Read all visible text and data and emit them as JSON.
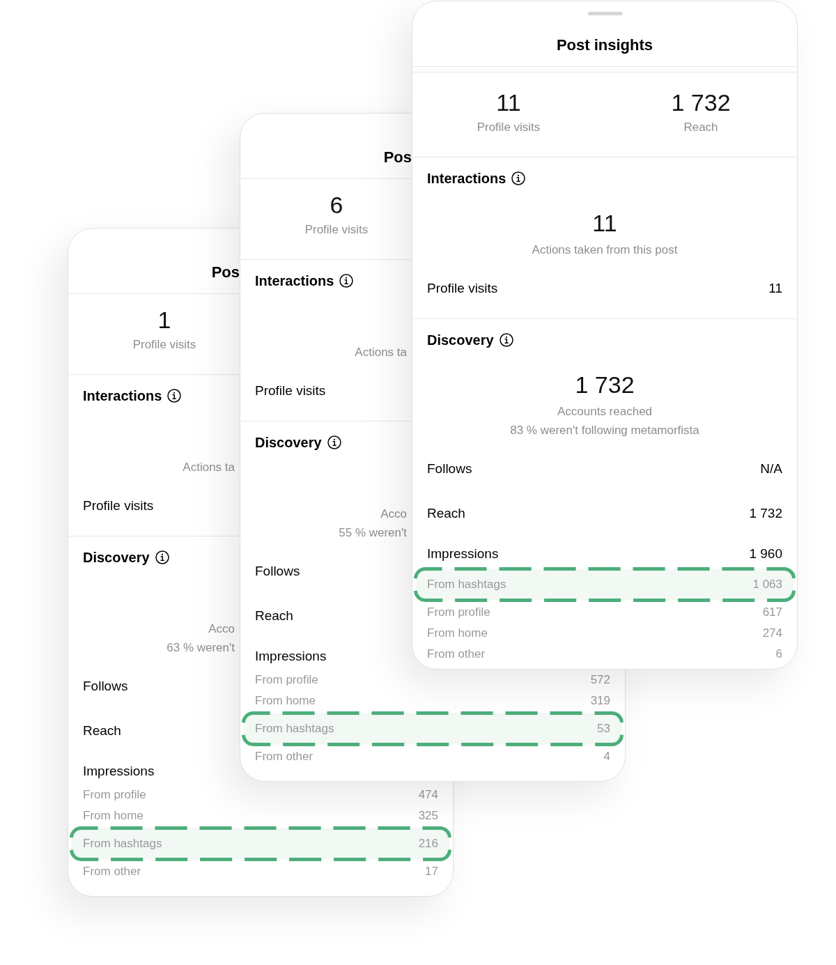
{
  "cards": [
    {
      "handle": false,
      "title": "Pos",
      "stats": [
        {
          "value": "1",
          "label": "Profile visits"
        }
      ],
      "sections": [
        {
          "heading": "Interactions",
          "caption": "Actions ta",
          "rows": [
            {
              "label": "Profile visits"
            }
          ]
        },
        {
          "heading": "Discovery",
          "caption": "Acco",
          "subcaption": "63 % weren't",
          "rows": [
            {
              "label": "Follows"
            },
            {
              "label": "Reach"
            },
            {
              "label": "Impressions",
              "breakdown": [
                {
                  "label": "From profile",
                  "value": "474",
                  "highlighted": false
                },
                {
                  "label": "From home",
                  "value": "325",
                  "highlighted": false
                },
                {
                  "label": "From hashtags",
                  "value": "216",
                  "highlighted": true
                },
                {
                  "label": "From other",
                  "value": "17",
                  "highlighted": false
                }
              ]
            }
          ]
        }
      ]
    },
    {
      "handle": false,
      "title": "Pos",
      "stats": [
        {
          "value": "6",
          "label": "Profile visits"
        }
      ],
      "sections": [
        {
          "heading": "Interactions",
          "caption": "Actions ta",
          "rows": [
            {
              "label": "Profile visits"
            }
          ]
        },
        {
          "heading": "Discovery",
          "caption": "Acco",
          "subcaption": "55 % weren't",
          "rows": [
            {
              "label": "Follows"
            },
            {
              "label": "Reach"
            },
            {
              "label": "Impressions",
              "breakdown": [
                {
                  "label": "From profile",
                  "value": "572",
                  "highlighted": false
                },
                {
                  "label": "From home",
                  "value": "319",
                  "highlighted": false
                },
                {
                  "label": "From hashtags",
                  "value": "53",
                  "highlighted": true
                },
                {
                  "label": "From other",
                  "value": "4",
                  "highlighted": false
                }
              ]
            }
          ]
        }
      ]
    },
    {
      "handle": true,
      "title": "Post insights",
      "stats": [
        {
          "value": "11",
          "label": "Profile visits"
        },
        {
          "value": "1 732",
          "label": "Reach"
        }
      ],
      "sections": [
        {
          "heading": "Interactions",
          "value": "11",
          "caption": "Actions taken from this post",
          "rows": [
            {
              "label": "Profile visits",
              "value": "11"
            }
          ]
        },
        {
          "heading": "Discovery",
          "value": "1 732",
          "caption": "Accounts reached",
          "subcaption": "83 % weren't following metamorfista",
          "rows": [
            {
              "label": "Follows",
              "value": "N/A"
            },
            {
              "label": "Reach",
              "value": "1 732"
            },
            {
              "label": "Impressions",
              "value": "1 960",
              "breakdown": [
                {
                  "label": "From hashtags",
                  "value": "1 063",
                  "highlighted": true
                },
                {
                  "label": "From profile",
                  "value": "617",
                  "highlighted": false
                },
                {
                  "label": "From home",
                  "value": "274",
                  "highlighted": false
                },
                {
                  "label": "From other",
                  "value": "6",
                  "highlighted": false
                }
              ]
            }
          ]
        }
      ]
    }
  ]
}
